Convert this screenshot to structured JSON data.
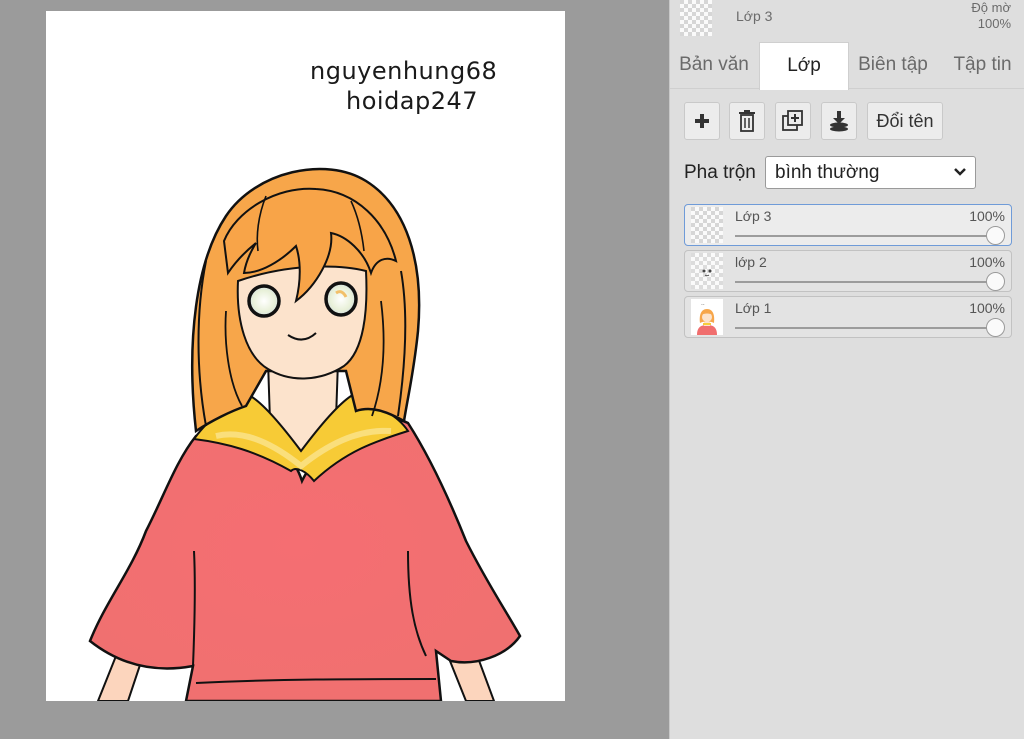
{
  "canvas": {
    "watermark_line1": "nguyenhung68",
    "watermark_line2": "hoidap247"
  },
  "panel": {
    "current_layer": {
      "name": "Lớp 3",
      "opacity_label": "Độ mờ",
      "opacity_value": "100%"
    },
    "tabs": [
      {
        "label": "Bản văn",
        "active": false
      },
      {
        "label": "Lớp",
        "active": true
      },
      {
        "label": "Biên tập",
        "active": false
      },
      {
        "label": "Tập tin",
        "active": false
      }
    ],
    "toolbar": {
      "add_icon": "plus-icon",
      "delete_icon": "trash-icon",
      "duplicate_icon": "duplicate-icon",
      "merge_icon": "merge-down-icon",
      "rename_label": "Đổi tên"
    },
    "blend": {
      "label": "Pha trộn",
      "value": "bình thường"
    },
    "layers": [
      {
        "name": "Lớp 3",
        "opacity": "100%",
        "opacity_value": 1.0,
        "selected": true
      },
      {
        "name": "lớp 2",
        "opacity": "100%",
        "opacity_value": 1.0,
        "selected": false
      },
      {
        "name": "Lớp 1",
        "opacity": "100%",
        "opacity_value": 1.0,
        "selected": false
      }
    ]
  },
  "colors": {
    "hair": "#f7a040",
    "skin": "#fce3cc",
    "dress": "#f06e6e",
    "collar": "#f6cd3a",
    "selected_border": "#6f9bd8"
  }
}
